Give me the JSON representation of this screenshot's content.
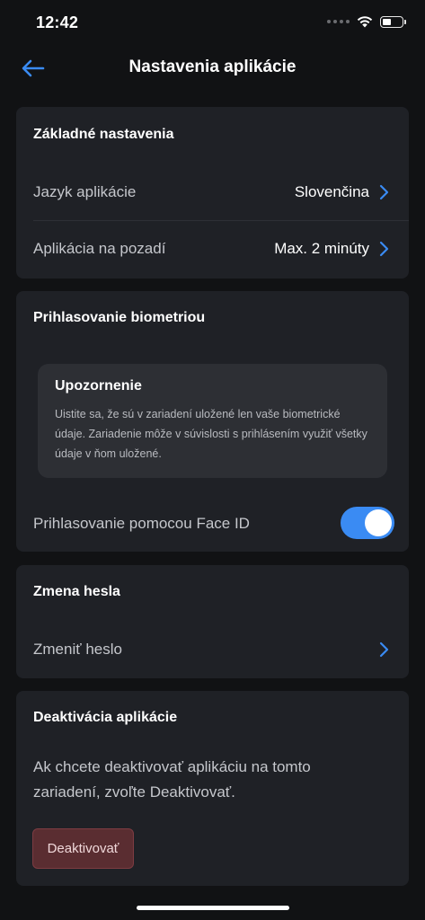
{
  "status": {
    "time": "12:42"
  },
  "nav": {
    "title": "Nastavenia aplikácie"
  },
  "basic": {
    "title": "Základné nastavenia",
    "language_label": "Jazyk aplikácie",
    "language_value": "Slovenčina",
    "background_label": "Aplikácia na pozadí",
    "background_value": "Max. 2 minúty"
  },
  "biometric": {
    "title": "Prihlasovanie biometriou",
    "notice_title": "Upozornenie",
    "notice_text": "Uistite sa, že sú v zariadení uložené len vaše biometrické údaje. Zariadenie môže v súvislosti s prihlásením využiť všetky údaje v ňom uložené.",
    "faceid_label": "Prihlasovanie pomocou Face ID",
    "faceid_enabled": true
  },
  "password": {
    "title": "Zmena hesla",
    "change_label": "Zmeniť heslo"
  },
  "deactivation": {
    "title": "Deaktivácia aplikácie",
    "text": "Ak chcete deaktivovať aplikáciu na tomto zariadení, zvoľte Deaktivovať.",
    "button_label": "Deaktivovať"
  },
  "colors": {
    "accent": "#3a8bf3",
    "background": "#111214",
    "card": "#1f2126",
    "danger_button": "#5a2d31"
  }
}
